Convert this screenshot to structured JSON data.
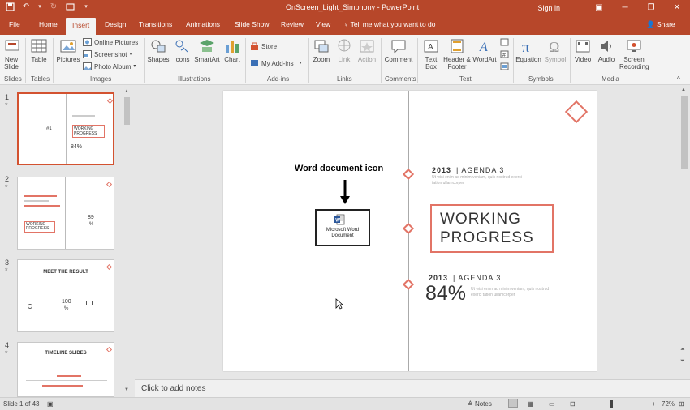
{
  "titlebar": {
    "title": "OnScreen_Light_Simphony - PowerPoint",
    "sign_in": "Sign in"
  },
  "tabs": [
    "File",
    "Home",
    "Insert",
    "Design",
    "Transitions",
    "Animations",
    "Slide Show",
    "Review",
    "View"
  ],
  "active_tab": "Insert",
  "tell_me": "Tell me what you want to do",
  "share": "Share",
  "ribbon": {
    "new_slide": "New Slide",
    "table": "Table",
    "pictures": "Pictures",
    "online_pictures": "Online Pictures",
    "screenshot": "Screenshot",
    "photo_album": "Photo Album",
    "shapes": "Shapes",
    "icons": "Icons",
    "smartart": "SmartArt",
    "chart": "Chart",
    "store": "Store",
    "my_addins": "My Add-ins",
    "zoom": "Zoom",
    "link": "Link",
    "action": "Action",
    "comment": "Comment",
    "text_box": "Text Box",
    "header_footer": "Header & Footer",
    "wordart": "WordArt",
    "equation": "Equation",
    "symbol": "Symbol",
    "video": "Video",
    "audio": "Audio",
    "screen_recording": "Screen Recording",
    "groups": {
      "slides": "Slides",
      "tables": "Tables",
      "images": "Images",
      "illustrations": "Illustrations",
      "addins": "Add-ins",
      "links": "Links",
      "comments": "Comments",
      "text": "Text",
      "symbols": "Symbols",
      "media": "Media"
    }
  },
  "thumbnails": [
    {
      "number": "1",
      "star": "*"
    },
    {
      "number": "2",
      "star": "*"
    },
    {
      "number": "3",
      "star": "*",
      "title": "MEET THE RESULT"
    },
    {
      "number": "4",
      "star": "*",
      "title": "TIMELINE SLIDES"
    }
  ],
  "thumb_text": {
    "t1_left_num": "#1",
    "t1_wp": "WORKING PROGRESS",
    "t1_pct": "84%",
    "t2_wp": "WORKING PROGRESS",
    "t2_num": "89",
    "t2_pct": "%",
    "t3_num": "100",
    "t3_pct": "%"
  },
  "slide": {
    "page_number": "1",
    "top_year": "2013",
    "top_agenda": "| AGENDA 3",
    "top_sub": "Ut wisi enim ad minim veniam, quis nostrud exerci tation ullamcorper",
    "working_progress_line1": "WORKING",
    "working_progress_line2": "PROGRESS",
    "bottom_year": "2013",
    "bottom_agenda": "| AGENDA 3",
    "percent": "84%",
    "bottom_sub": "Ut wisi enim ad minim veniam, quis nostrud exerci tation ullamcorper",
    "annotation": "Word document icon",
    "embedded_object_label": "Microsoft Word Document"
  },
  "notes_placeholder": "Click to add notes",
  "status": {
    "slide_counter": "Slide 1 of 43",
    "notes": "Notes",
    "zoom": "72%"
  },
  "colors": {
    "accent": "#b7472a",
    "slide_accent": "#e27466"
  }
}
